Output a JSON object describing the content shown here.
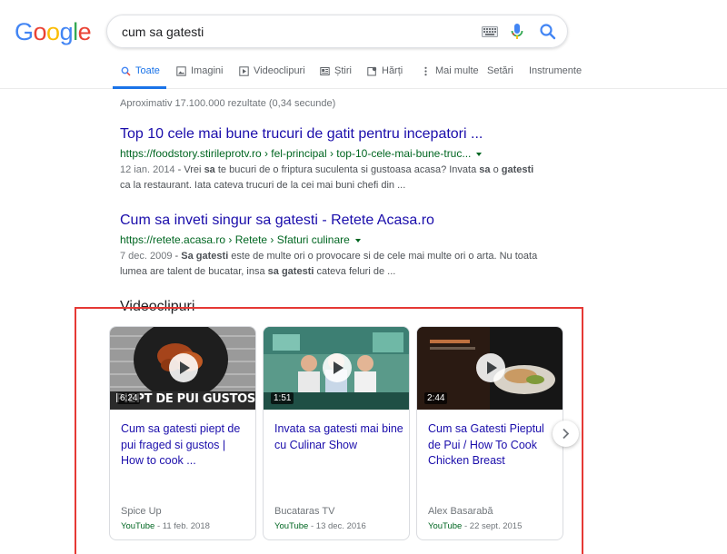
{
  "logo": {
    "text": "Google"
  },
  "search": {
    "query": "cum sa gatesti"
  },
  "tabs": [
    {
      "label": "Toate",
      "icon": "search-icon",
      "active": true
    },
    {
      "label": "Imagini",
      "icon": "image-icon"
    },
    {
      "label": "Videoclipuri",
      "icon": "video-icon"
    },
    {
      "label": "Știri",
      "icon": "news-icon"
    },
    {
      "label": "Hărți",
      "icon": "map-icon"
    },
    {
      "label": "Mai multe",
      "icon": "more-icon"
    },
    {
      "label": "Setări"
    },
    {
      "label": "Instrumente"
    }
  ],
  "stats": "Aproximativ 17.100.000 rezultate (0,34 secunde)",
  "results": [
    {
      "title": "Top 10 cele mai bune trucuri de gatit pentru incepatori ...",
      "url": "https://foodstory.stirileprotv.ro › fel-principal › top-10-cele-mai-bune-truc...",
      "date": "12 ian. 2014",
      "line1_a": " - Vrei ",
      "line1_b1": "sa",
      "line1_c": " te bucuri de o friptura suculenta si gustoasa acasa? Invata ",
      "line1_b2": "sa",
      "line1_d": " o ",
      "line1_b3": "gatesti",
      "line2": "ca la restaurant. Iata cateva trucuri de la cei mai buni chefi din ..."
    },
    {
      "title": "Cum sa inveti singur sa gatesti - Retete Acasa.ro",
      "url": "https://retete.acasa.ro › Retete › Sfaturi culinare",
      "date": "7 dec. 2009",
      "line1_a": " - ",
      "line1_b1": "Sa gatesti",
      "line1_c": " este de multe ori o provocare si de cele mai multe ori o arta. Nu toata",
      "line2_a": "lumea are talent de bucatar, insa ",
      "line2_b": "sa gatesti",
      "line2_c": " cateva feluri de ..."
    }
  ],
  "videos": {
    "heading": "Videoclipuri",
    "items": [
      {
        "title": "Cum sa gatesti piept de pui fraged si gustos | How to cook ...",
        "duration": "6:24",
        "channel": "Spice Up",
        "source": "YouTube",
        "date": " - 11 feb. 2018",
        "overlay": "PIEPT DE PUI GUSTOS"
      },
      {
        "title": "Invata sa gatesti mai bine cu Culinar Show",
        "duration": "1:51",
        "channel": "Bucataras TV",
        "source": "YouTube",
        "date": " - 13 dec. 2016"
      },
      {
        "title": "Cum sa Gatesti Pieptul de Pui / How To Cook Chicken Breast",
        "duration": "2:44",
        "channel": "Alex Basarabă",
        "source": "YouTube",
        "date": " - 22 sept. 2015"
      }
    ]
  },
  "colors": {
    "link": "#1a0dab",
    "url": "#006621",
    "accent": "#1a73e8",
    "highlight_box": "#e53935"
  }
}
